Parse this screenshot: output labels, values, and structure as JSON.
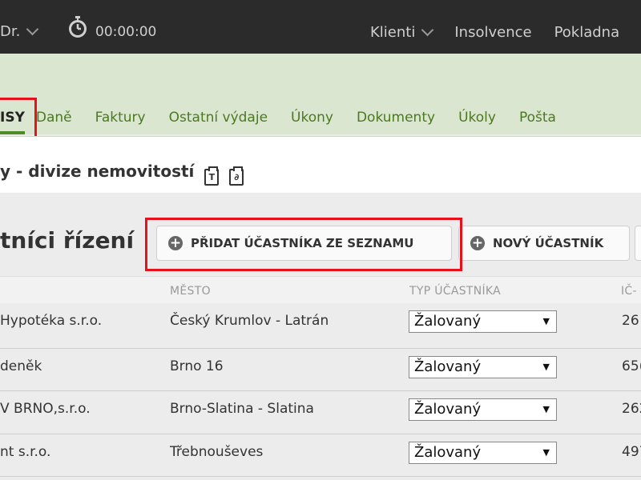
{
  "topbar": {
    "user_label": "Dr.",
    "timer_value": "00:00:00",
    "nav": [
      {
        "label": "Klienti",
        "has_dropdown": true
      },
      {
        "label": "Insolvence",
        "has_dropdown": false
      },
      {
        "label": "Pokladna",
        "has_dropdown": false
      }
    ]
  },
  "tabs": [
    {
      "label": "ISY",
      "active": true
    },
    {
      "label": "Daně"
    },
    {
      "label": "Faktury"
    },
    {
      "label": "Ostatní výdaje"
    },
    {
      "label": "Úkony"
    },
    {
      "label": "Dokumenty"
    },
    {
      "label": "Úkoly"
    },
    {
      "label": "Pošta"
    }
  ],
  "page_title": "y - divize nemovitostí",
  "section": {
    "heading": "tníci řízení",
    "add_from_list_label": "PŘIDAT ÚČASTNÍKA ZE SEZNAMU",
    "new_participant_label": "NOVÝ ÚČASTNÍK"
  },
  "table": {
    "headers": {
      "city": "MĚSTO",
      "type": "TYP ÚČASTNÍKA",
      "ic": "IČ-"
    },
    "rows": [
      {
        "name": "Hypotéka s.r.o.",
        "city": "Český Krumlov - Latrán",
        "type": "Žalovaný",
        "ic": "26"
      },
      {
        "name": "deněk",
        "city": "Brno 16",
        "type": "Žalovaný",
        "ic": "65("
      },
      {
        "name": "V BRNO,s.r.o.",
        "city": "Brno-Slatina - Slatina",
        "type": "Žalovaný",
        "ic": "262"
      },
      {
        "name": "nt s.r.o.",
        "city": "Třebnouševes",
        "type": "Žalovaný",
        "ic": "497"
      }
    ]
  },
  "colors": {
    "topbar": "#2b2b2b",
    "tab_green": "#4a7a1f",
    "highlight_red": "#e8101a",
    "header_green": "#dbe6d0"
  },
  "icons": [
    "chevron-down-icon",
    "stopwatch-icon",
    "plus-circle-icon",
    "clipboard-text-icon",
    "clipboard-link-icon",
    "select-arrow-icon"
  ]
}
